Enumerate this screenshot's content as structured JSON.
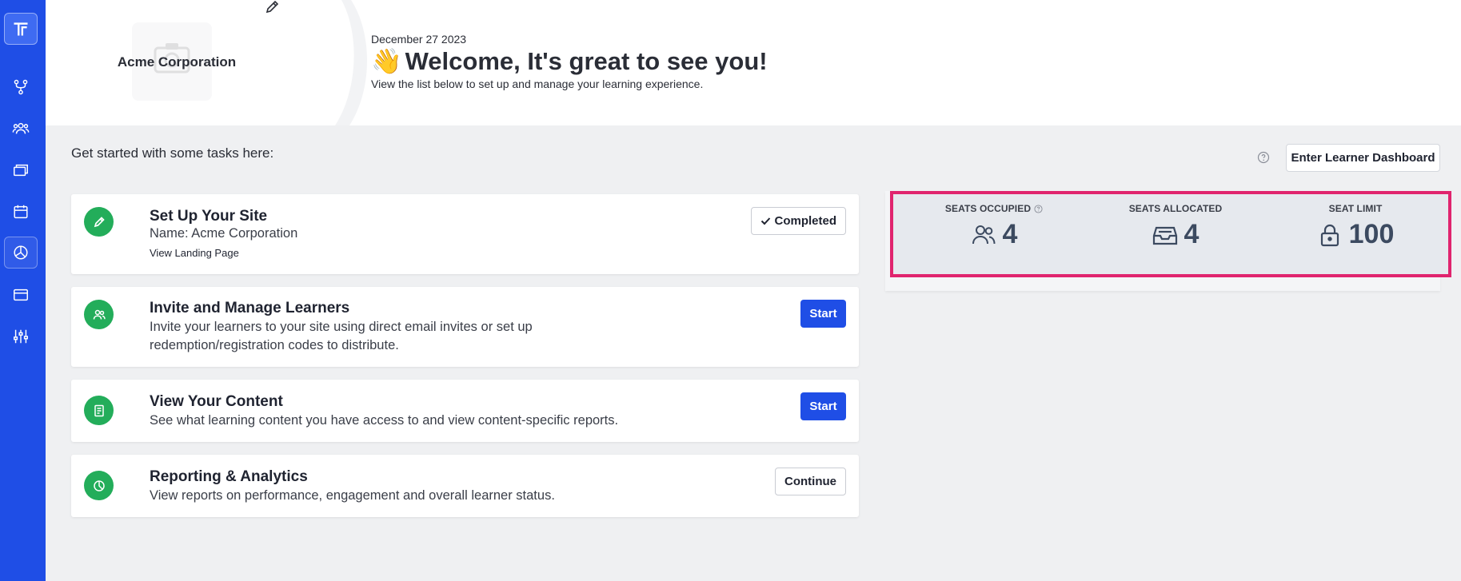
{
  "header": {
    "org_name": "Acme Corporation",
    "date": "December 27 2023",
    "wave_emoji": "👋",
    "welcome": "Welcome, It's great to see you!",
    "subtitle": "View the list below to set up and manage your learning experience."
  },
  "main": {
    "intro": "Get started with some tasks here:",
    "learner_dashboard_button": "Enter Learner Dashboard",
    "tasks": [
      {
        "icon": "pencil-icon",
        "title": "Set Up Your Site",
        "desc": "Name: Acme Corporation",
        "link": "View Landing Page",
        "button": "Completed",
        "button_icon": "check-icon"
      },
      {
        "icon": "users-icon",
        "title": "Invite and Manage Learners",
        "desc": "Invite your learners to your site using direct email invites or set up redemption/registration codes to distribute.",
        "button": "Start"
      },
      {
        "icon": "content-icon",
        "title": "View Your Content",
        "desc": "See what learning content you have access to and view content-specific reports.",
        "button": "Start"
      },
      {
        "icon": "chart-icon",
        "title": "Reporting & Analytics",
        "desc": "View reports on performance, engagement and overall learner status.",
        "button": "Continue"
      }
    ]
  },
  "seats": {
    "occupied": {
      "label": "SEATS OCCUPIED",
      "value": "4",
      "icon": "users-icon"
    },
    "allocated": {
      "label": "SEATS ALLOCATED",
      "value": "4",
      "icon": "inbox-icon"
    },
    "limit": {
      "label": "SEAT LIMIT",
      "value": "100",
      "icon": "lock-icon"
    }
  },
  "sidebar": {
    "items": [
      "logo-icon",
      "workflow-icon",
      "users-icon",
      "library-icon",
      "calendar-icon",
      "chart-icon",
      "window-icon",
      "sliders-icon"
    ],
    "active": "chart-icon"
  },
  "colors": {
    "sidebar": "#1f4ee6",
    "primary": "#1f4ee6",
    "task_icon": "#23ad5a",
    "highlight": "#e0246e"
  }
}
